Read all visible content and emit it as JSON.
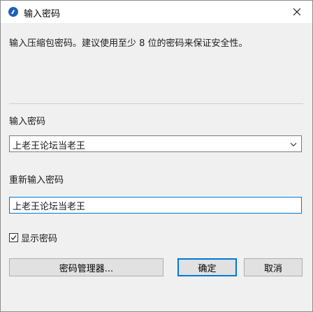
{
  "window": {
    "title": "输入密码",
    "close_icon": "close-icon",
    "app_icon": "app-logo-icon",
    "accent_color": "#0078d4"
  },
  "description": "输入压缩包密码。建议使用至少 8 位的密码来保证安全性。",
  "password_field": {
    "label": "输入密码",
    "value": "上老王论坛当老王",
    "icon": "chevron-down-icon"
  },
  "confirm_field": {
    "label": "重新输入密码",
    "value": "上老王论坛当老王"
  },
  "show_password": {
    "label": "显示密码",
    "checked": true
  },
  "buttons": {
    "manager_label": "密码管理器...",
    "ok_label": "确定",
    "cancel_label": "取消"
  }
}
